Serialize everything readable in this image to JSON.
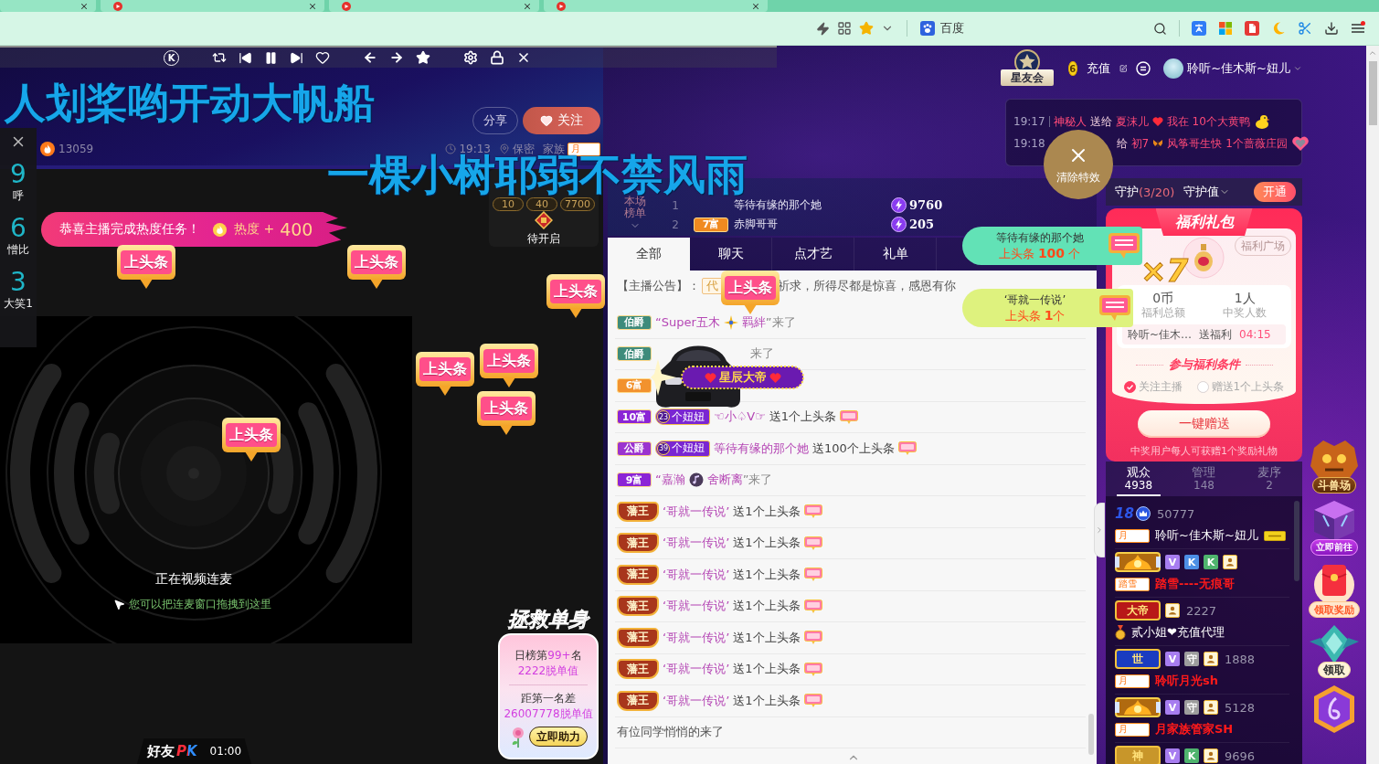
{
  "browser": {
    "tabs": [
      {
        "favicon": false
      },
      {
        "favicon": true
      },
      {
        "favicon": true
      },
      {
        "favicon": true
      }
    ],
    "bookmark": "百度"
  },
  "player": {
    "logo": "K"
  },
  "lyrics": [
    "人划桨哟开动大帆船",
    "一棵小树耶弱不禁风雨"
  ],
  "stream": {
    "share": "分享",
    "follow": "关注",
    "popularity": "13059",
    "time": "19:13",
    "location": "保密",
    "family": "家族",
    "family_badge": "月"
  },
  "side_rank": [
    {
      "rank": "9",
      "name": "呼"
    },
    {
      "rank": "6",
      "name": "憎比"
    },
    {
      "rank": "3",
      "name": "大笑1"
    }
  ],
  "task_banner": {
    "text": "恭喜主播完成热度任务！",
    "heat_label": "热度 +",
    "heat_amount": "400"
  },
  "pk_box": {
    "counts": [
      "10",
      "40",
      "7700"
    ],
    "status": "待开启"
  },
  "video": {
    "title": "正在视频连麦",
    "hint": "您可以把连麦窗口拖拽到这里"
  },
  "rescue": {
    "title": "拯救单身",
    "rank_prefix": "日榜第",
    "rank": "99+",
    "rank_suffix": "名",
    "value": "2222脱单值",
    "gap_label": "距第一名差",
    "gap_value": "26007778脱单值",
    "button": "立即助力"
  },
  "pk_bar": {
    "label": "好友",
    "logo": "PK",
    "time": "01:00"
  },
  "stickers": [
    "上头条",
    "上头条",
    "上头条",
    "上头条",
    "上头条",
    "上头条",
    "上头条",
    "上头条"
  ],
  "header": {
    "logo": "星友会",
    "level": "6",
    "recharge": "充值",
    "user": "聆听~佳木斯~妞儿"
  },
  "notices": [
    {
      "kind": "full",
      "time": "19:17",
      "sender": "神秘人",
      "verb": "送给",
      "receiver": "夏沫儿",
      "message": "我在",
      "gift": "10个大黄鸭"
    },
    {
      "kind": "covered",
      "time": "19:18",
      "verb": "给",
      "receiver": "初7",
      "message": "风筝哥生快",
      "gift": "1个蔷薇庄园"
    }
  ],
  "clear_effects": "清除特效",
  "rank_list": {
    "title": "本场榜单",
    "rows": [
      {
        "rank": "1",
        "name": "等待有缘的那个她",
        "score": "9760"
      },
      {
        "rank": "2",
        "badge": "7富",
        "name": "赤脚哥哥",
        "score": "205"
      }
    ]
  },
  "chat_tabs": [
    {
      "label": "全部",
      "selected": true
    },
    {
      "label": "聊天",
      "selected": false
    },
    {
      "label": "点才艺",
      "selected": false
    },
    {
      "label": "礼单",
      "selected": false
    }
  ],
  "announcement": {
    "label": "【主播公告】：",
    "tag": "代",
    "text": "祈求，所得尽都是惊喜，感恩有你"
  },
  "chat": [
    {
      "kind": "enter",
      "badge": {
        "kind": "tag",
        "text": "伯爵",
        "color": "#3e8b7b"
      },
      "prefix": "“",
      "name_parts": [
        "Super五木",
        "羁絆"
      ],
      "suffix": "”来了"
    },
    {
      "kind": "covered",
      "badge": {
        "kind": "tag",
        "text": "伯爵",
        "color": "#3e8b7b"
      },
      "suffix": "来了"
    },
    {
      "kind": "covered",
      "badge": {
        "kind": "tag",
        "text": "6富",
        "color": "#f2922e"
      }
    },
    {
      "kind": "gift",
      "badge": {
        "kind": "tag",
        "text": "10富",
        "color": "#8b25d6"
      },
      "fan": {
        "level": "23",
        "name": "个妞妞"
      },
      "user": "☜小♤V☞",
      "action": "送1个上头条"
    },
    {
      "kind": "gift",
      "badge": {
        "kind": "tag",
        "text": "公爵",
        "color": "#9b33cf"
      },
      "fan": {
        "level": "39",
        "name": "个妞妞"
      },
      "user": "等待有缘的那个她",
      "action": "送100个上头条"
    },
    {
      "kind": "enter",
      "badge": {
        "kind": "tag",
        "text": "9富",
        "color": "#8b25d6"
      },
      "prefix": "“",
      "name_parts": [
        "嘉瀚",
        "舍断离"
      ],
      "suffix": "”来了"
    },
    {
      "kind": "gift",
      "badge": {
        "kind": "crest",
        "text": "藩王",
        "color": "#a8361c"
      },
      "user": "‘哥就一传说’",
      "action": "送1个上头条"
    },
    {
      "kind": "gift",
      "badge": {
        "kind": "crest",
        "text": "藩王",
        "color": "#a8361c"
      },
      "user": "‘哥就一传说’",
      "action": "送1个上头条"
    },
    {
      "kind": "gift",
      "badge": {
        "kind": "crest",
        "text": "藩王",
        "color": "#a8361c"
      },
      "user": "‘哥就一传说’",
      "action": "送1个上头条"
    },
    {
      "kind": "gift",
      "badge": {
        "kind": "crest",
        "text": "藩王",
        "color": "#a8361c"
      },
      "user": "‘哥就一传说’",
      "action": "送1个上头条"
    },
    {
      "kind": "gift",
      "badge": {
        "kind": "crest",
        "text": "藩王",
        "color": "#a8361c"
      },
      "user": "‘哥就一传说’",
      "action": "送1个上头条"
    },
    {
      "kind": "gift",
      "badge": {
        "kind": "crest",
        "text": "藩王",
        "color": "#a8361c"
      },
      "user": "‘哥就一传说’",
      "action": "送1个上头条"
    },
    {
      "kind": "gift",
      "badge": {
        "kind": "crest",
        "text": "藩王",
        "color": "#a8361c"
      },
      "user": "‘哥就一传说’",
      "action": "送1个上头条"
    },
    {
      "kind": "system",
      "text": "有位同学悄悄的来了"
    }
  ],
  "car_effect": {
    "name": "星辰大帝"
  },
  "banners": [
    {
      "name": "等待有缘的那个她",
      "count": "上头条 **100** 个",
      "color": "#62e2b6"
    },
    {
      "name": "‘哥就一传说’",
      "count": "上头条 **1**个",
      "color": "#def27e"
    }
  ],
  "guard": {
    "label": "守护",
    "count": "(3/20)",
    "value_label": "守护值",
    "open": "开通"
  },
  "welfare": {
    "title": "福利礼包",
    "plaza": "福利广场",
    "combo": "×7",
    "amount": "0币",
    "amount_label": "福利总额",
    "winners": "1人",
    "winners_label": "中奖人数",
    "host": "聆听~佳木…",
    "action": "送福利",
    "countdown": "04:15",
    "conditions_title": "参与福利条件",
    "conditions": [
      {
        "label": "关注主播",
        "checked": true
      },
      {
        "label": "赠送1个上头条",
        "checked": false
      }
    ],
    "button": "一键赠送",
    "note": "中奖用户每人可获赠1个奖励礼物"
  },
  "audience_tabs": [
    {
      "label": "观众",
      "count": "4938",
      "selected": true
    },
    {
      "label": "管理",
      "count": "148",
      "selected": false
    },
    {
      "label": "麦序",
      "count": "2",
      "selected": false
    }
  ],
  "audience": [
    {
      "emblem": {
        "kind": "level",
        "text": "18"
      },
      "score": "50777",
      "badge": "月",
      "name": "聆听~佳木斯~妞儿",
      "color": "#ffffff",
      "name_icon": true
    },
    {
      "emblem": {
        "kind": "frame"
      },
      "tags": [
        {
          "kind": "letter",
          "text": "V",
          "color": "#a77df0"
        },
        {
          "kind": "letter",
          "text": "K",
          "color": "#4d8fe6"
        },
        {
          "kind": "letter",
          "text": "K",
          "color": "#4fb46e"
        },
        {
          "kind": "person"
        }
      ],
      "badge": "踏雪",
      "name": "踏雪----无痕哥",
      "color": "#ff1a1a"
    },
    {
      "emblem": {
        "kind": "plate",
        "text": "大帝",
        "color": "#b81818"
      },
      "tags": [
        {
          "kind": "person"
        }
      ],
      "score": "2227",
      "medal": true,
      "name": "贰小姐❤充值代理",
      "color": "#ffffff"
    },
    {
      "emblem": {
        "kind": "plate",
        "text": "世",
        "color": "#1a3cc0"
      },
      "tags": [
        {
          "kind": "letter",
          "text": "V",
          "color": "#a77df0"
        },
        {
          "kind": "letter",
          "text": "守",
          "color": "#9d9d9d"
        },
        {
          "kind": "person"
        }
      ],
      "score": "1888",
      "badge": "月",
      "name": "聆听月光sh",
      "color": "#ff1a1a"
    },
    {
      "emblem": {
        "kind": "frame"
      },
      "tags": [
        {
          "kind": "letter",
          "text": "V",
          "color": "#a77df0"
        },
        {
          "kind": "letter",
          "text": "守",
          "color": "#9d9d9d"
        },
        {
          "kind": "person"
        }
      ],
      "score": "5128",
      "badge": "月",
      "name": "月家族管家SH",
      "color": "#ff1a1a"
    },
    {
      "emblem": {
        "kind": "plate",
        "text": "神",
        "color": "#c8962a"
      },
      "tags": [
        {
          "kind": "letter",
          "text": "V",
          "color": "#a77df0"
        },
        {
          "kind": "letter",
          "text": "K",
          "color": "#4fb46e"
        },
        {
          "kind": "person"
        }
      ],
      "score": "9696"
    }
  ],
  "side_icons": [
    {
      "kind": "arena",
      "label": "斗兽场"
    },
    {
      "kind": "cube",
      "label": "立即前往"
    },
    {
      "kind": "redpacket",
      "label": "领取奖励"
    },
    {
      "kind": "crystal",
      "label": "领取"
    },
    {
      "kind": "member"
    }
  ]
}
